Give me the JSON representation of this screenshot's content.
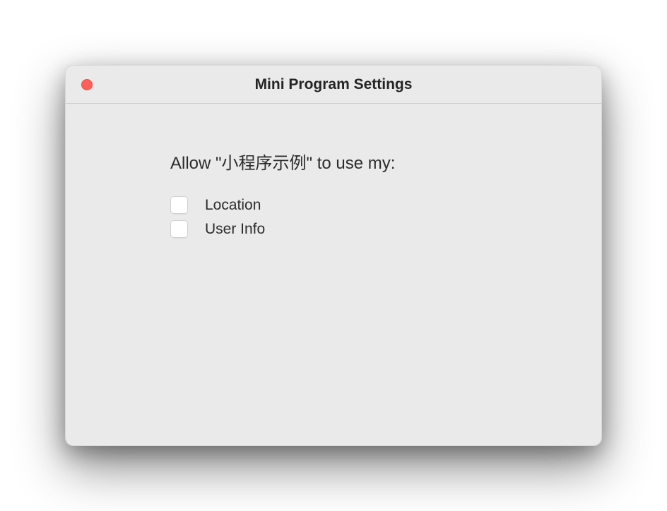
{
  "window": {
    "title": "Mini Program Settings"
  },
  "prompt": {
    "text": "Allow \"小程序示例\" to use my:"
  },
  "permissions": [
    {
      "label": "Location",
      "checked": false
    },
    {
      "label": "User Info",
      "checked": false
    }
  ]
}
